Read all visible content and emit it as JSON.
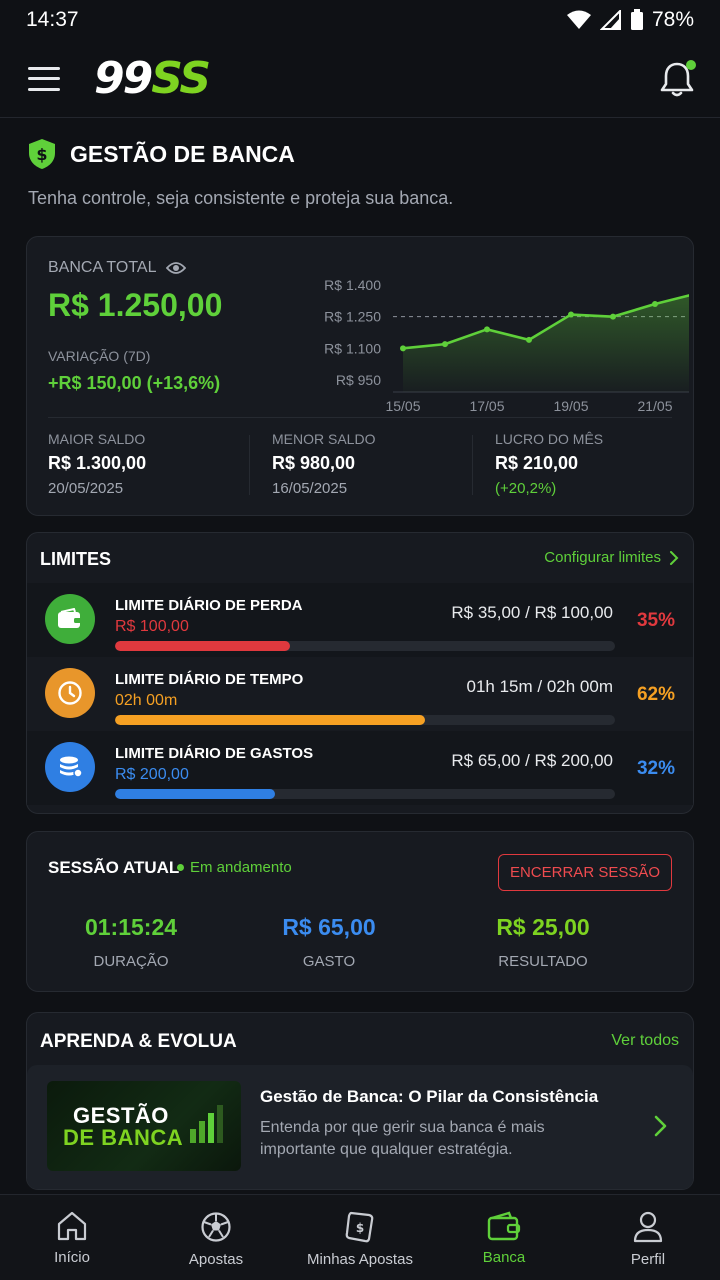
{
  "status_bar": {
    "time": "14:37",
    "battery": "78%"
  },
  "header": {
    "logo_part1": "99",
    "logo_part2": "SS"
  },
  "page": {
    "title": "GESTÃO DE BANCA",
    "subtitle": "Tenha controle, seja consistente e proteja sua banca."
  },
  "bank": {
    "label": "BANCA TOTAL",
    "value": "R$ 1.250,00",
    "variation_label": "VARIAÇÃO (7D)",
    "variation_value": "+R$ 150,00 (+13,6%)",
    "stats": [
      {
        "label": "MAIOR SALDO",
        "value": "R$ 1.300,00",
        "sub": "20/05/2025"
      },
      {
        "label": "MENOR SALDO",
        "value": "R$ 980,00",
        "sub": "16/05/2025"
      },
      {
        "label": "LUCRO DO MÊS",
        "value": "R$ 210,00",
        "sub": "(+20,2%)"
      }
    ]
  },
  "chart_data": {
    "type": "area",
    "x_tick_labels": [
      "15/05",
      "17/05",
      "19/05",
      "21/05"
    ],
    "y_tick_labels": [
      "R$ 1.400",
      "R$ 1.250",
      "R$ 1.100",
      "R$ 950"
    ],
    "y_ticks": [
      1400,
      1250,
      1100,
      950
    ],
    "x": [
      "15/05",
      "16/05",
      "17/05",
      "18/05",
      "19/05",
      "20/05",
      "21/05",
      "22/05"
    ],
    "values": [
      1100,
      1120,
      1190,
      1140,
      1260,
      1250,
      1310,
      1360
    ],
    "reference_line": 1250,
    "ylim": [
      950,
      1400
    ],
    "color": "#5fd03a",
    "grid": false
  },
  "limits": {
    "title": "LIMITES",
    "configure_label": "Configurar limites",
    "items": [
      {
        "title": "LIMITE DIÁRIO DE PERDA",
        "limit": "R$ 100,00",
        "amount": "R$ 35,00 / R$ 100,00",
        "percent": "35%",
        "progress": 0.35,
        "color": "#e0393e",
        "icon": "wallet-icon",
        "icon_bg": "#3fae3a"
      },
      {
        "title": "LIMITE DIÁRIO DE TEMPO",
        "limit": "02h 00m",
        "amount": "01h 15m / 02h 00m",
        "percent": "62%",
        "progress": 0.62,
        "color": "#f5a023",
        "icon": "clock-icon",
        "icon_bg": "#e8962b"
      },
      {
        "title": "LIMITE DIÁRIO DE GASTOS",
        "limit": "R$ 200,00",
        "amount": "R$ 65,00 / R$ 200,00",
        "percent": "32%",
        "progress": 0.32,
        "color": "#2f7fe3",
        "icon": "coins-icon",
        "icon_bg": "#2f7fe3"
      }
    ]
  },
  "session": {
    "title": "SESSÃO ATUAL",
    "status": "Em andamento",
    "end_button": "ENCERRAR SESSÃO",
    "metrics": [
      {
        "value": "01:15:24",
        "label": "DURAÇÃO",
        "color": "#5fd03a"
      },
      {
        "value": "R$ 65,00",
        "label": "GASTO",
        "color": "#3b8cf0"
      },
      {
        "value": "R$ 25,00",
        "label": "RESULTADO",
        "color": "#7ed321"
      }
    ]
  },
  "learn": {
    "title": "APRENDA & EVOLUA",
    "see_all": "Ver todos",
    "item": {
      "thumb_line1": "GESTÃO",
      "thumb_line2": "DE BANCA",
      "title": "Gestão de Banca: O Pilar da Consistência",
      "description": "Entenda por que gerir sua banca é mais importante que qualquer estratégia."
    }
  },
  "nav": {
    "items": [
      {
        "label": "Início",
        "icon": "home-icon"
      },
      {
        "label": "Apostas",
        "icon": "soccer-ball-icon"
      },
      {
        "label": "Minhas Apostas",
        "icon": "ticket-icon"
      },
      {
        "label": "Banca",
        "icon": "wallet-icon",
        "active": true
      },
      {
        "label": "Perfil",
        "icon": "user-icon"
      }
    ]
  }
}
